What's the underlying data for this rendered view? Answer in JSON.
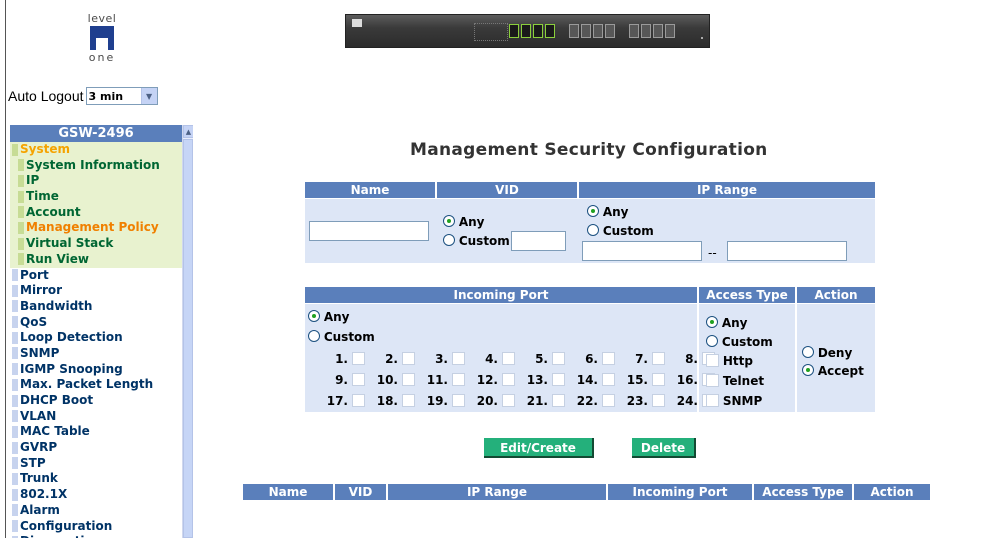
{
  "logo": {
    "top_text": "level",
    "bottom_text": "one"
  },
  "auto_logout": {
    "label": "Auto Logout",
    "value": "3 min"
  },
  "sidebar": {
    "header": "GSW-2496",
    "items": [
      {
        "label": "System",
        "kind": "sys"
      },
      {
        "label": "System Information",
        "kind": "sub"
      },
      {
        "label": "IP",
        "kind": "sub"
      },
      {
        "label": "Time",
        "kind": "sub"
      },
      {
        "label": "Account",
        "kind": "sub"
      },
      {
        "label": "Management Policy",
        "kind": "sub-active"
      },
      {
        "label": "Virtual Stack",
        "kind": "sub"
      },
      {
        "label": "Run View",
        "kind": "sub"
      },
      {
        "label": "Port",
        "kind": "top"
      },
      {
        "label": "Mirror",
        "kind": "top"
      },
      {
        "label": "Bandwidth",
        "kind": "top"
      },
      {
        "label": "QoS",
        "kind": "top"
      },
      {
        "label": "Loop Detection",
        "kind": "top"
      },
      {
        "label": "SNMP",
        "kind": "top"
      },
      {
        "label": "IGMP Snooping",
        "kind": "top"
      },
      {
        "label": "Max. Packet Length",
        "kind": "top"
      },
      {
        "label": "DHCP Boot",
        "kind": "top"
      },
      {
        "label": "VLAN",
        "kind": "top"
      },
      {
        "label": "MAC Table",
        "kind": "top"
      },
      {
        "label": "GVRP",
        "kind": "top"
      },
      {
        "label": "STP",
        "kind": "top"
      },
      {
        "label": "Trunk",
        "kind": "top"
      },
      {
        "label": "802.1X",
        "kind": "top"
      },
      {
        "label": "Alarm",
        "kind": "top"
      },
      {
        "label": "Configuration",
        "kind": "top"
      },
      {
        "label": "Diagnostics",
        "kind": "top"
      }
    ]
  },
  "main": {
    "title": "Management Security Configuration",
    "table1": {
      "headers": {
        "name": "Name",
        "vid": "VID",
        "ip_range": "IP Range"
      },
      "name_value": "",
      "vid_any": "Any",
      "vid_custom": "Custom",
      "vid_value": "",
      "vid_selected": "Any",
      "ip_any": "Any",
      "ip_custom": "Custom",
      "ip_selected": "Any",
      "ip_from": "",
      "ip_sep": "--",
      "ip_to": ""
    },
    "table2": {
      "headers": {
        "incoming_port": "Incoming Port",
        "access_type": "Access Type",
        "action": "Action"
      },
      "port_any": "Any",
      "port_custom": "Custom",
      "port_selected": "Any",
      "ports": [
        "1.",
        "2.",
        "3.",
        "4.",
        "5.",
        "6.",
        "7.",
        "8.",
        "9.",
        "10.",
        "11.",
        "12.",
        "13.",
        "14.",
        "15.",
        "16.",
        "17.",
        "18.",
        "19.",
        "20.",
        "21.",
        "22.",
        "23.",
        "24."
      ],
      "access": {
        "any": "Any",
        "custom": "Custom",
        "http": "Http",
        "telnet": "Telnet",
        "snmp": "SNMP",
        "selected": "Any"
      },
      "action": {
        "deny": "Deny",
        "accept": "Accept",
        "selected": "Accept"
      }
    },
    "buttons": {
      "edit_create": "Edit/Create",
      "delete": "Delete"
    },
    "list_headers": {
      "name": "Name",
      "vid": "VID",
      "ip_range": "IP Range",
      "incoming_port": "Incoming Port",
      "access_type": "Access Type",
      "action": "Action"
    }
  },
  "colors": {
    "header_blue": "#5a7fbb",
    "panel": "#dde6f6",
    "button_green": "#24b07b",
    "submenu_bg": "#e8f2cf",
    "active_orange": "#f08000"
  }
}
